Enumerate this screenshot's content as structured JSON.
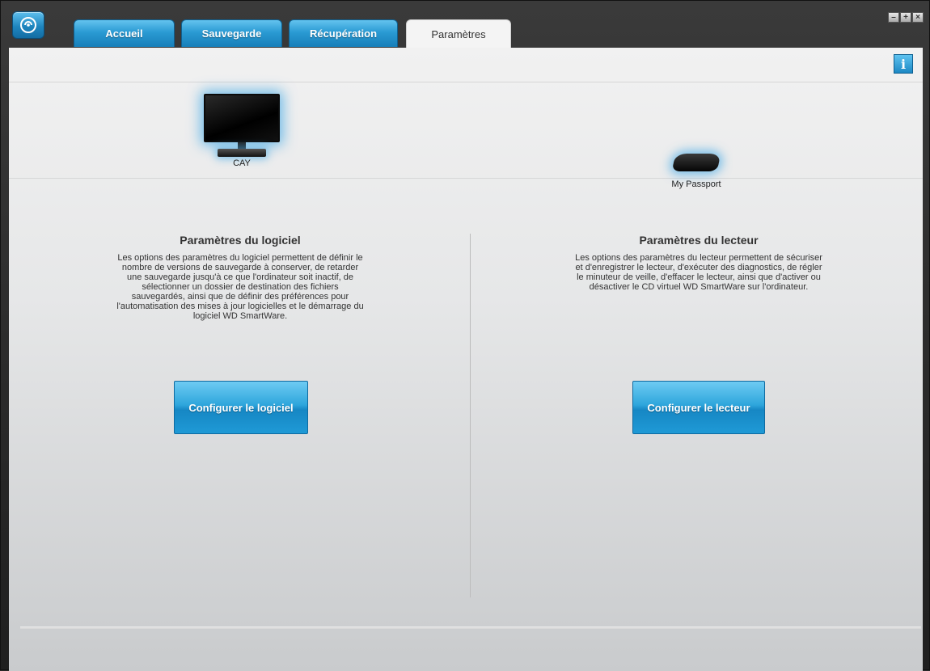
{
  "app": {
    "logo_icon": "wd-smartware-logo-icon",
    "accent_color": "#1f9ad6"
  },
  "tabs": [
    {
      "label": "Accueil",
      "active": false
    },
    {
      "label": "Sauvegarde",
      "active": false
    },
    {
      "label": "Récupération",
      "active": false
    },
    {
      "label": "Paramètres",
      "active": true
    }
  ],
  "window_controls": {
    "minimize_icon": "minimize-icon",
    "maximize_icon": "maximize-icon",
    "close_icon": "close-icon"
  },
  "info_button": {
    "icon": "info-icon"
  },
  "devices": {
    "computer": {
      "label": "CAY",
      "icon": "monitor-icon"
    },
    "drive": {
      "label": "My Passport",
      "icon": "hard-drive-icon"
    }
  },
  "software_panel": {
    "title": "Paramètres du logiciel",
    "description": "Les options des paramètres du logiciel permettent de définir le nombre de versions de sauvegarde à conserver, de retarder une sauvegarde jusqu'à ce que l'ordinateur soit inactif, de sélectionner un dossier de destination des fichiers sauvegardés, ainsi que de définir des préférences pour l'automatisation des mises à jour logicielles et le démarrage du logiciel WD SmartWare.",
    "button_label": "Configurer le logiciel"
  },
  "drive_panel": {
    "title": "Paramètres du lecteur",
    "description": "Les options des paramètres du lecteur permettent de sécuriser et d'enregistrer le lecteur, d'exécuter des diagnostics, de régler le minuteur de veille, d'effacer le lecteur, ainsi que d'activer ou désactiver le CD virtuel WD SmartWare sur l'ordinateur.",
    "button_label": "Configurer le lecteur"
  }
}
